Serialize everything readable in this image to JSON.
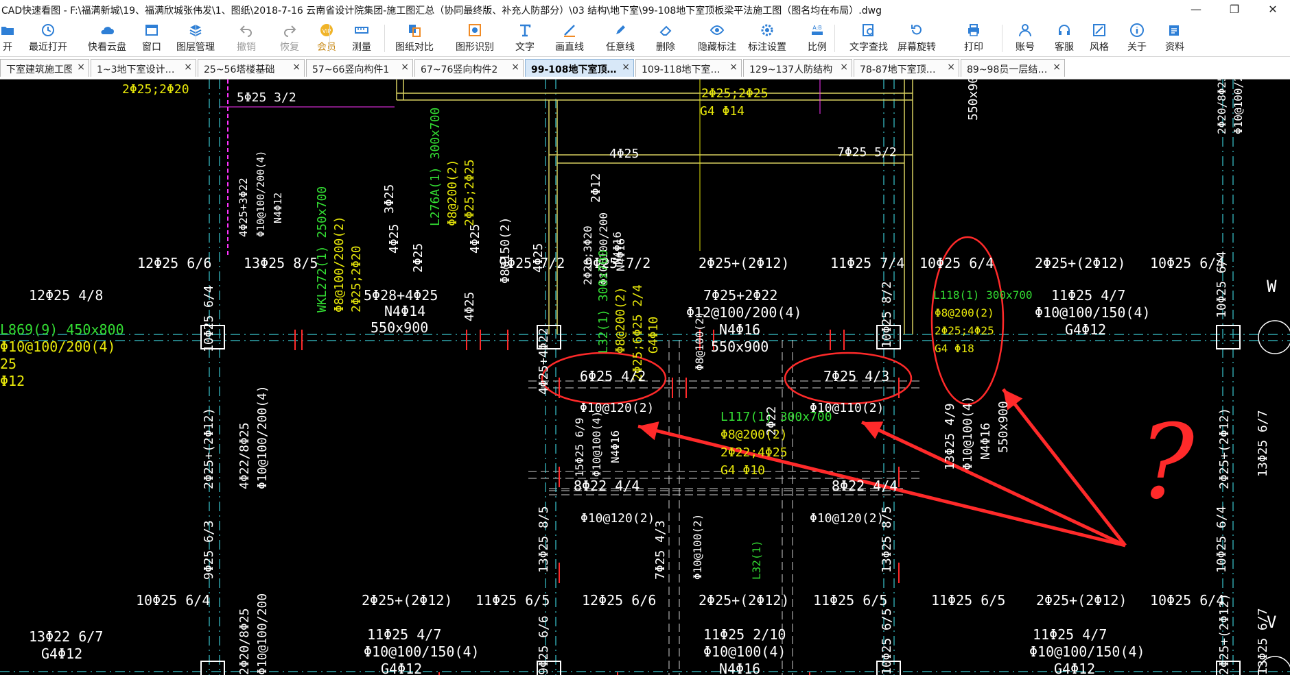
{
  "window": {
    "title": "CAD快速看图 - F:\\福满新城\\19、福满欣城张伟发\\1、图纸\\2018-7-16 云南省设计院集团-施工图汇总（协同最终版、补充人防部分）\\03 结构\\地下室\\99-108地下室顶板梁平法施工图（图名均在布局）.dwg",
    "minimize_icon": "minimize-icon",
    "maximize_icon": "restore-icon",
    "close_icon": "close-icon"
  },
  "toolbar": {
    "items": [
      {
        "label": "开",
        "icon": "open-icon"
      },
      {
        "label": "最近打开",
        "icon": "recent-icon"
      },
      {
        "label": "快看云盘",
        "icon": "cloud-icon"
      },
      {
        "label": "窗口",
        "icon": "window-icon"
      },
      {
        "label": "图层管理",
        "icon": "layers-icon"
      },
      {
        "label": "撤销",
        "icon": "undo-icon"
      },
      {
        "label": "恢复",
        "icon": "redo-icon"
      },
      {
        "label": "会员",
        "icon": "vip-icon"
      },
      {
        "label": "测量",
        "icon": "ruler-icon"
      },
      {
        "label": "图纸对比",
        "icon": "compare-icon"
      },
      {
        "label": "图形识别",
        "icon": "recognize-icon"
      },
      {
        "label": "文字",
        "icon": "text-icon"
      },
      {
        "label": "画直线",
        "icon": "line-icon"
      },
      {
        "label": "任意线",
        "icon": "pen-icon"
      },
      {
        "label": "删除",
        "icon": "eraser-icon"
      },
      {
        "label": "隐藏标注",
        "icon": "eye-icon"
      },
      {
        "label": "标注设置",
        "icon": "settings-icon"
      },
      {
        "label": "比例",
        "icon": "scale-icon"
      },
      {
        "label": "文字查找",
        "icon": "find-text-icon"
      },
      {
        "label": "屏幕旋转",
        "icon": "rotate-icon"
      },
      {
        "label": "打印",
        "icon": "print-icon"
      },
      {
        "label": "账号",
        "icon": "user-icon"
      },
      {
        "label": "客服",
        "icon": "headset-icon"
      },
      {
        "label": "风格",
        "icon": "style-icon"
      },
      {
        "label": "关于",
        "icon": "info-icon"
      },
      {
        "label": "资料",
        "icon": "docs-icon"
      }
    ]
  },
  "tabs": [
    {
      "label": "下室建筑施工图"
    },
    {
      "label": "1~3地下室设计…"
    },
    {
      "label": "25~56塔楼基础"
    },
    {
      "label": "57~66竖向构件1"
    },
    {
      "label": "67~76竖向构件2"
    },
    {
      "label": "99-108地下室顶…"
    },
    {
      "label": "109-118地下室…"
    },
    {
      "label": "129~137人防结构"
    },
    {
      "label": "78-87地下室顶…"
    },
    {
      "label": "89~98员一层结…"
    }
  ],
  "tab_close_glyph": "×",
  "drawing": {
    "colors": {
      "background": "#000000",
      "text": "#ffffff",
      "green": "#33dd33",
      "yellow": "#e8e80a",
      "cyan": "#3ac8d0",
      "magenta": "#ff33ff",
      "red": "#ff2a2a",
      "beam_yellow": "#d8d060"
    },
    "texts": [
      "2Φ25;2Φ20",
      "5Φ25 3/2",
      "4Φ25+3Φ22",
      "Φ10@100/200(4)",
      "N4Φ12",
      "WKL272(1) 250x700",
      "Φ8@100/200(2)",
      "2Φ25;2Φ20",
      "3Φ25",
      "L276A(1) 300x700",
      "Φ8@200(2)",
      "2Φ25;2Φ25",
      "2Φ25",
      "Φ8@150(2)",
      "4Φ25",
      "2Φ12",
      "4Φ25",
      "2Φ20;3Φ20",
      "Φ10@100/200",
      "N4Φ16",
      "2Φ25;2Φ25",
      "G4 Φ14",
      "7Φ25 5/2",
      "4Φ25",
      "N4Φ16",
      "550x900",
      "2Φ20/8Φ25",
      "Φ10@100/200",
      "12Φ25 6/6",
      "13Φ25 8/5",
      "4Φ25",
      "4Φ25",
      "9Φ25 7/2",
      "9Φ25 7/2",
      "2Φ25+(2Φ12)",
      "11Φ25 7/4",
      "10Φ25 6/4",
      "2Φ25+(2Φ12)",
      "10Φ25 6/4",
      "10Φ25 6/4",
      "W",
      "12Φ25 4/8",
      "5Φ28+4Φ25",
      "N4Φ14",
      "550x900",
      "4Φ25+4Φ22",
      "L32(1) 300x700",
      "Φ8@200(2)",
      "2Φ25;6Φ25 2/4",
      "G4Φ10",
      "7Φ25+2Φ22",
      "Φ12@100/200(4)",
      "N4Φ16",
      "550x900",
      "Φ8@100(2)",
      "10Φ25 8/2",
      "L118(1) 300x700",
      "Φ8@200(2)",
      "2Φ25;4Φ25",
      "G4 Φ18",
      "11Φ25 4/7",
      "Φ10@100/150(4)",
      "G4Φ12",
      "L869(9) 450x800",
      "Φ10@100/200(4)",
      "25",
      "Φ12",
      "10Φ25 6/4",
      "6Φ25 4/2",
      "7Φ25 4/3",
      "Φ10@120(2)",
      "Φ10@110(2)",
      "2Φ25+(2Φ12)",
      "4Φ22/8Φ25",
      "Φ10@100/200(4)",
      "15Φ25 6/9",
      "Φ10@100(4)",
      "N4Φ16",
      "L117(1) 300x700",
      "Φ8@200(2)",
      "2Φ22;4Φ25",
      "G4 Φ10",
      "2Φ22",
      "13Φ25 4/9",
      "Φ10@100(4)",
      "N4Φ16",
      "550x900",
      "2Φ25+(2Φ12)",
      "13Φ25 6/7",
      "8Φ22 4/4",
      "8Φ22 4/4",
      "Φ10@120(2)",
      "Φ10@120(2)",
      "L32(1)",
      "9Φ25 6/3",
      "13Φ25 8/5",
      "7Φ25 4/3",
      "Φ10@100(2)",
      "13Φ25 8/5",
      "10Φ25 6/4",
      "10Φ25 6/4",
      "2Φ25+(2Φ12)",
      "11Φ25 6/5",
      "12Φ25 6/6",
      "2Φ25+(2Φ12)",
      "11Φ25 6/5",
      "11Φ25 6/5",
      "2Φ25+(2Φ12)",
      "10Φ25 6/4",
      "V",
      "13Φ22 6/7",
      "G4Φ12",
      "11Φ25 4/7",
      "Φ10@100/150(4)",
      "G4Φ12",
      "11Φ25 2/10",
      "Φ10@100(4)",
      "N4Φ16",
      "550x900",
      "11Φ25 4/7",
      "Φ10@100/150(4)",
      "G4Φ12",
      "9Φ25 6/6",
      "10Φ25 6/5",
      "2Φ20/8Φ25",
      "Φ10@100/200",
      "2Φ25+(2Φ12)",
      "13Φ25 6/7"
    ],
    "annotation_question": "?"
  }
}
